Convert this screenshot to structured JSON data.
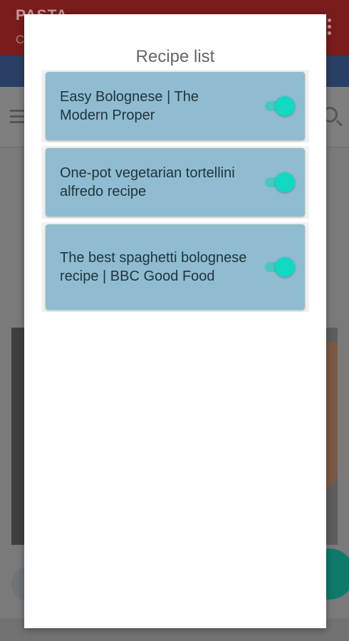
{
  "background_app": {
    "title": "PASTA",
    "subtitle": "C"
  },
  "dialog": {
    "title": "Recipe list",
    "recipes": [
      {
        "name": "Easy Bolognese | The Modern Proper",
        "enabled": true
      },
      {
        "name": "One-pot vegetarian tortellini alfredo recipe",
        "enabled": true
      },
      {
        "name": "The best spaghetti bolognese recipe | BBC Good Food",
        "enabled": true
      }
    ]
  },
  "colors": {
    "card": "#8fbcd0",
    "toggle_on": "#12d8c4",
    "app_bar": "#7a1c1c"
  }
}
